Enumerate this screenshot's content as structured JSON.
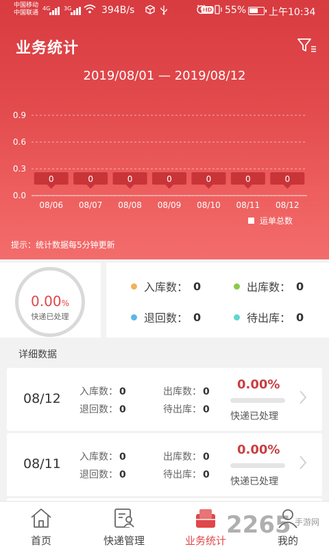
{
  "status_bar": {
    "carrier1": "中国移动",
    "carrier2": "中国联通",
    "net1": "4G",
    "net2": "3G",
    "speed": "394B/s",
    "hd": "HD",
    "battery_percent": "55%",
    "time": "上午10:34"
  },
  "header": {
    "title": "业务统计",
    "filter_icon": "filter-icon",
    "date_range": "2019/08/01 — 2019/08/12"
  },
  "chart_data": {
    "type": "bar",
    "categories": [
      "08/06",
      "08/07",
      "08/08",
      "08/09",
      "08/10",
      "08/11",
      "08/12"
    ],
    "series": [
      {
        "name": "运单总数",
        "values": [
          0,
          0,
          0,
          0,
          0,
          0,
          0
        ]
      }
    ],
    "y_ticks": [
      "0.0",
      "0.3",
      "0.6",
      "0.9"
    ],
    "ylim": [
      0,
      0.9
    ],
    "grid": true,
    "legend_placement": "bottom-right"
  },
  "hint": "提示：统计数据每5分钟更新",
  "summary": {
    "percent": "0.00",
    "percent_unit": "%",
    "percent_label": "快递已处理",
    "stats": [
      {
        "label": "入库数：",
        "value": "0",
        "color": "#f0b35a"
      },
      {
        "label": "出库数：",
        "value": "0",
        "color": "#8cc84b"
      },
      {
        "label": "退回数：",
        "value": "0",
        "color": "#5bb7ea"
      },
      {
        "label": "待出库：",
        "value": "0",
        "color": "#5fd6d3"
      }
    ]
  },
  "detail_title": "详细数据",
  "details": [
    {
      "date": "08/12",
      "in_label": "入库数：",
      "in": "0",
      "out_label": "出库数：",
      "out": "0",
      "ret_label": "退回数：",
      "ret": "0",
      "wait_label": "待出库：",
      "wait": "0",
      "percent": "0.00%",
      "progress": 0,
      "processed_label": "快递已处理"
    },
    {
      "date": "08/11",
      "in_label": "入库数：",
      "in": "0",
      "out_label": "出库数：",
      "out": "0",
      "ret_label": "退回数：",
      "ret": "0",
      "wait_label": "待出库：",
      "wait": "0",
      "percent": "0.00%",
      "progress": 0,
      "processed_label": "快递已处理"
    }
  ],
  "tabs": [
    {
      "label": "首页",
      "icon": "home-icon",
      "active": false
    },
    {
      "label": "快递管理",
      "icon": "parcel-management-icon",
      "active": false
    },
    {
      "label": "业务统计",
      "icon": "statistics-icon",
      "active": true
    },
    {
      "label": "我的",
      "icon": "profile-icon",
      "active": false
    }
  ],
  "accent_color": "#e0474a",
  "watermark": "2265",
  "watermark_sub": "手游网"
}
